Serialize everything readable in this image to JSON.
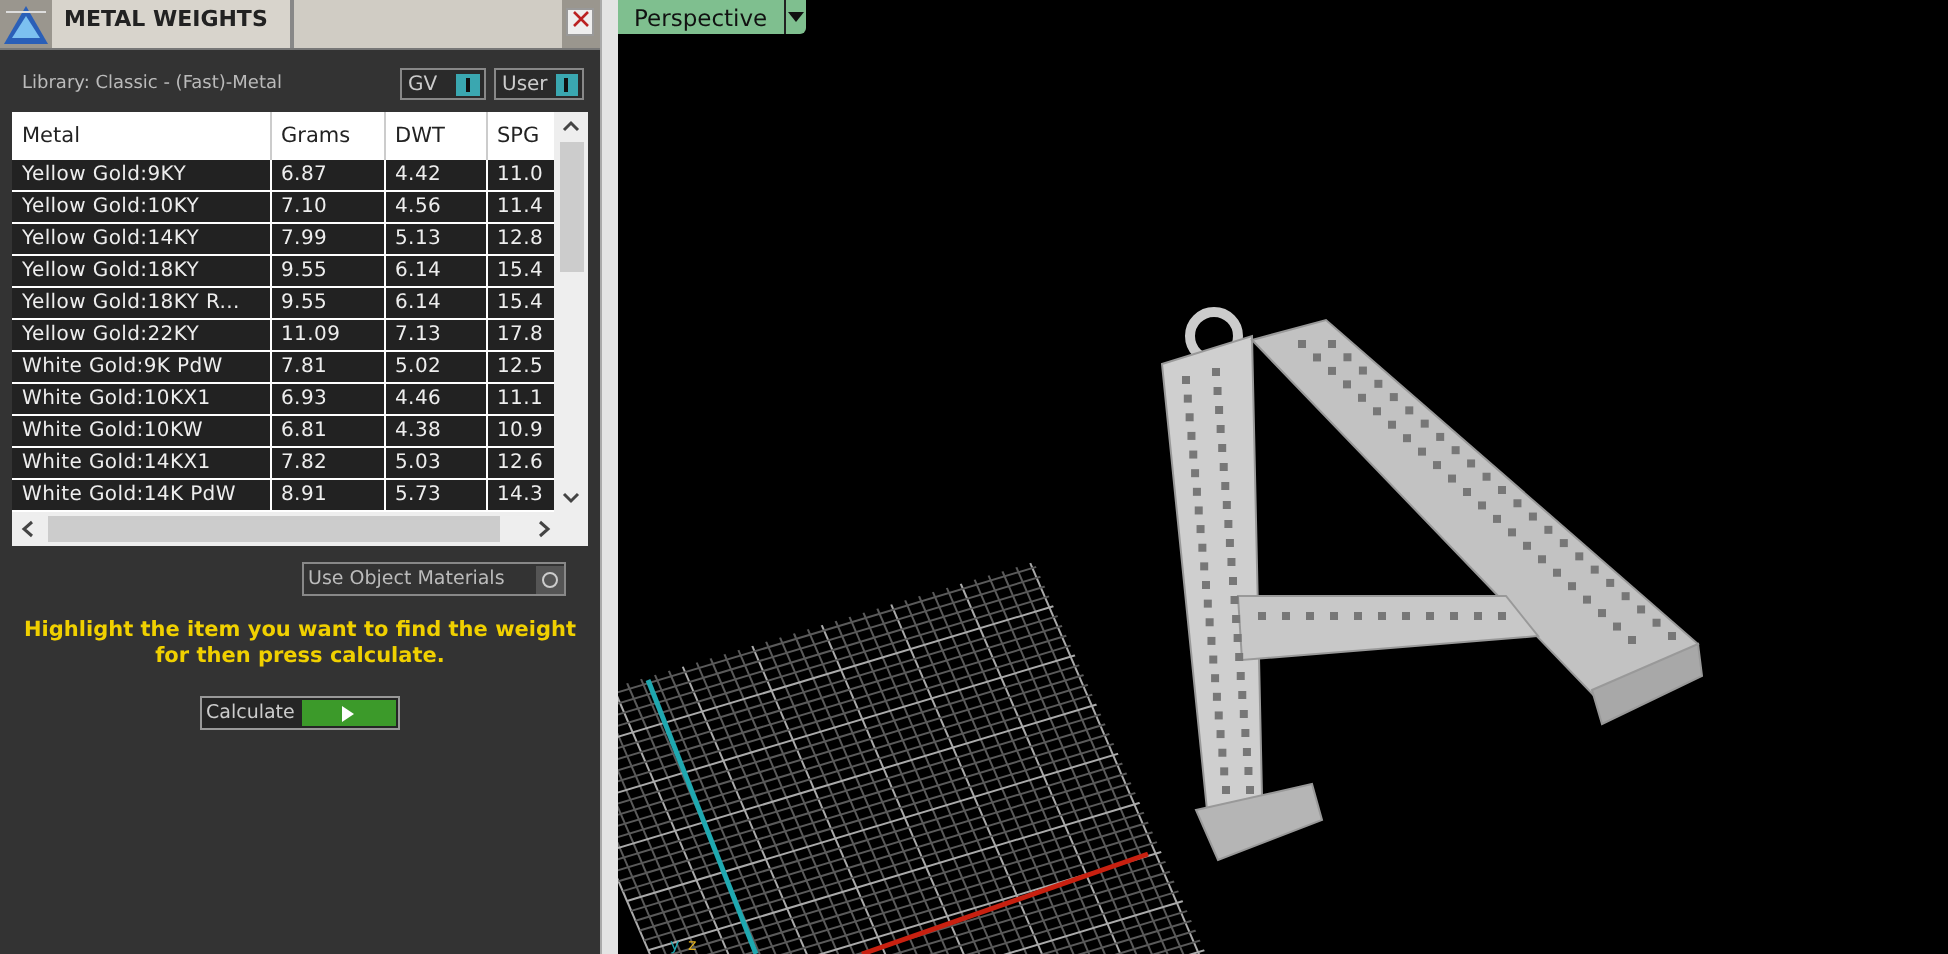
{
  "panel": {
    "title": "METAL WEIGHTS",
    "library": "Library: Classic - (Fast)-Metal",
    "toggles": [
      {
        "label": "GV",
        "on": true
      },
      {
        "label": "User",
        "on": true
      }
    ],
    "table": {
      "columns": [
        "Metal",
        "Grams",
        "DWT",
        "SPG"
      ],
      "rows": [
        {
          "cells": [
            "Yellow Gold:9KY",
            "6.87",
            "4.42",
            "11.0"
          ],
          "selected": false
        },
        {
          "cells": [
            "Yellow Gold:10KY",
            "7.10",
            "4.56",
            "11.4"
          ],
          "selected": false
        },
        {
          "cells": [
            "Yellow Gold:14KY",
            "7.99",
            "5.13",
            "12.8"
          ],
          "selected": false
        },
        {
          "cells": [
            "Yellow Gold:18KY",
            "9.55",
            "6.14",
            "15.4"
          ],
          "selected": false
        },
        {
          "cells": [
            "Yellow Gold:18KY R...",
            "9.55",
            "6.14",
            "15.4"
          ],
          "selected": false
        },
        {
          "cells": [
            "Yellow Gold:22KY",
            "11.09",
            "7.13",
            "17.8"
          ],
          "selected": false
        },
        {
          "cells": [
            "White Gold:9K PdW",
            "7.81",
            "5.02",
            "12.5"
          ],
          "selected": false
        },
        {
          "cells": [
            "White Gold:10KX1",
            "6.93",
            "4.46",
            "11.1"
          ],
          "selected": false
        },
        {
          "cells": [
            "White Gold:10KW",
            "6.81",
            "4.38",
            "10.9"
          ],
          "selected": false
        },
        {
          "cells": [
            "White Gold:14KX1",
            "7.82",
            "5.03",
            "12.6"
          ],
          "selected": false
        },
        {
          "cells": [
            "White Gold:14K PdW",
            "8.91",
            "5.73",
            "14.3"
          ],
          "selected": false
        }
      ]
    },
    "use_object_materials": {
      "label": "Use Object Materials",
      "checked": false
    },
    "message": "Highlight the item you want to find the weight for then press calculate.",
    "calculate_button": "Calculate"
  },
  "viewport": {
    "view_tab": "Perspective",
    "axis_labels": [
      "y",
      "z"
    ]
  }
}
